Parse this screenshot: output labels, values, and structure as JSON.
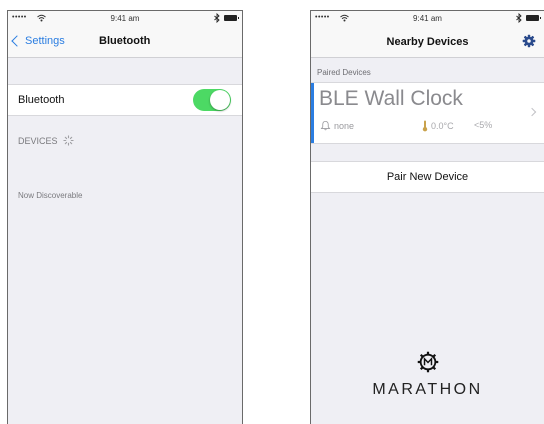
{
  "left_screen": {
    "status_bar": {
      "signal": "•••••",
      "time": "9:41 am"
    },
    "nav": {
      "back_label": "Settings",
      "title": "Bluetooth"
    },
    "bluetooth_row": {
      "label": "Bluetooth",
      "toggle_on": true
    },
    "devices_header": "DEVICES",
    "discoverable_text": "Now Discoverable"
  },
  "right_screen": {
    "status_bar": {
      "signal": "•••••",
      "time": "9:41 am"
    },
    "nav": {
      "title": "Nearby Devices"
    },
    "paired_header": "Paired Devices",
    "device": {
      "name": "BLE Wall Clock",
      "alarm": "none",
      "temperature": "0.0°C",
      "humidity": "<5%"
    },
    "pair_button": "Pair New Device",
    "brand": "MARATHON"
  },
  "colors": {
    "accent_blue": "#2a7de1",
    "toggle_green": "#4cd964",
    "background_gray": "#efeff4"
  },
  "icons": [
    "wifi-icon",
    "bluetooth-icon",
    "battery-icon",
    "back-chevron-icon",
    "gear-icon",
    "spinner-icon",
    "bell-icon",
    "thermometer-icon",
    "chevron-right-icon",
    "marathon-logo-icon"
  ]
}
